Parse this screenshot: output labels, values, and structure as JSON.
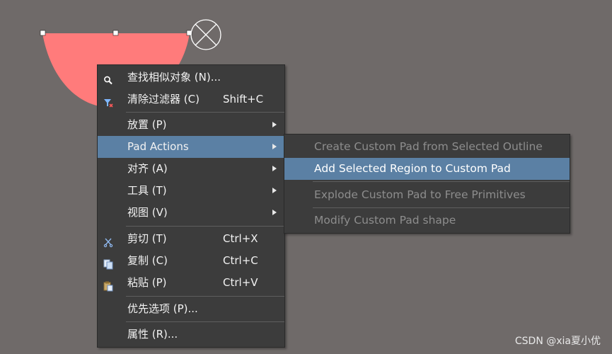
{
  "context_menu": {
    "items": [
      {
        "label": "查找相似对象 (N)...",
        "shortcut": "",
        "icon": "find-similar-icon",
        "has_submenu": false
      },
      {
        "label": "清除过滤器 (C)",
        "shortcut": "Shift+C",
        "icon": "clear-filter-icon",
        "has_submenu": false
      },
      {
        "label": "放置 (P)",
        "shortcut": "",
        "icon": "",
        "has_submenu": true
      },
      {
        "label": "Pad Actions",
        "shortcut": "",
        "icon": "",
        "has_submenu": true
      },
      {
        "label": "对齐 (A)",
        "shortcut": "",
        "icon": "",
        "has_submenu": true
      },
      {
        "label": "工具 (T)",
        "shortcut": "",
        "icon": "",
        "has_submenu": true
      },
      {
        "label": "视图 (V)",
        "shortcut": "",
        "icon": "",
        "has_submenu": true
      },
      {
        "label": "剪切 (T)",
        "shortcut": "Ctrl+X",
        "icon": "cut-icon",
        "has_submenu": false
      },
      {
        "label": "复制 (C)",
        "shortcut": "Ctrl+C",
        "icon": "copy-icon",
        "has_submenu": false
      },
      {
        "label": "粘贴 (P)",
        "shortcut": "Ctrl+V",
        "icon": "paste-icon",
        "has_submenu": false
      },
      {
        "label": "优先选项 (P)...",
        "shortcut": "",
        "icon": "",
        "has_submenu": false
      },
      {
        "label": "属性 (R)...",
        "shortcut": "",
        "icon": "",
        "has_submenu": false
      }
    ],
    "highlighted_item": "Pad Actions"
  },
  "pad_actions_submenu": {
    "items": [
      {
        "label": "Create Custom Pad from Selected Outline",
        "enabled": false
      },
      {
        "label": "Add Selected Region to Custom Pad",
        "enabled": true
      },
      {
        "label": "Explode Custom Pad to Free Primitives",
        "enabled": false
      },
      {
        "label": "Modify Custom Pad shape",
        "enabled": false
      }
    ],
    "highlighted_item": "Add Selected Region to Custom Pad"
  },
  "watermark": "CSDN @xia夏小优",
  "colors": {
    "canvas_background": "#6f6a69",
    "selected_region_fill": "#ff7b7b",
    "menu_background": "#3c3c3c",
    "menu_highlight": "#5b80a4",
    "disabled_text": "#8d8d8d"
  }
}
